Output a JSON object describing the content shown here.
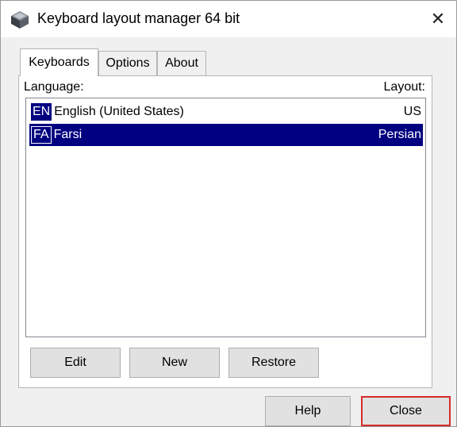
{
  "window": {
    "title": "Keyboard layout manager 64 bit"
  },
  "tabs": [
    {
      "label": "Keyboards",
      "active": true
    },
    {
      "label": "Options",
      "active": false
    },
    {
      "label": "About",
      "active": false
    }
  ],
  "list": {
    "header_language": "Language:",
    "header_layout": "Layout:",
    "rows": [
      {
        "code": "EN",
        "language": "English (United States)",
        "layout": "US",
        "selected": false
      },
      {
        "code": "FA",
        "language": "Farsi",
        "layout": "Persian",
        "selected": true
      }
    ]
  },
  "buttons": {
    "edit": "Edit",
    "new": "New",
    "restore": "Restore",
    "help": "Help",
    "close": "Close"
  },
  "icons": {
    "app": "keyboard-app-icon",
    "close": "close-icon"
  },
  "colors": {
    "selection": "#000080",
    "highlight_border": "#d72b2b"
  }
}
